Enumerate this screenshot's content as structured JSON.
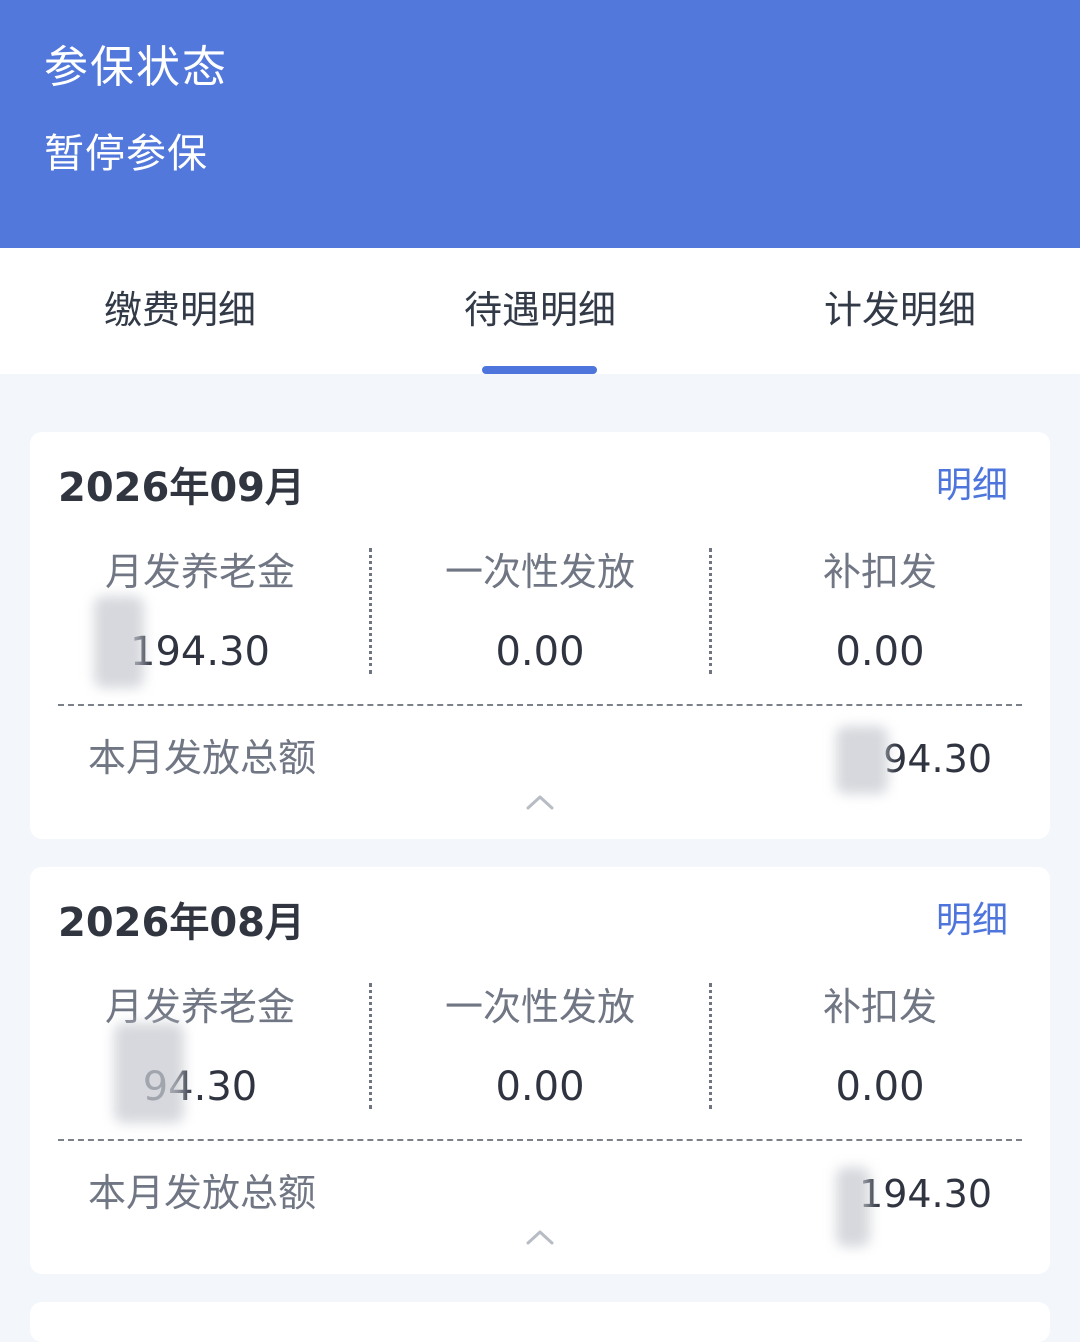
{
  "header": {
    "title": "参保状态",
    "status": "暂停参保"
  },
  "tabs": [
    {
      "label": "缴费明细",
      "active": false
    },
    {
      "label": "待遇明细",
      "active": true
    },
    {
      "label": "计发明细",
      "active": false
    }
  ],
  "colors": {
    "header_bg": "#5378dc",
    "accent": "#4e75dc",
    "page_bg": "#f3f6fa"
  },
  "cards": [
    {
      "month": "2026年09月",
      "detail_link": "明细",
      "columns": [
        {
          "label": "月发养老金",
          "value": "194.30"
        },
        {
          "label": "一次性发放",
          "value": "0.00"
        },
        {
          "label": "补扣发",
          "value": "0.00"
        }
      ],
      "total_label": "本月发放总额",
      "total_value": "94.30",
      "collapse_icon": "chevron-up-icon"
    },
    {
      "month": "2026年08月",
      "detail_link": "明细",
      "columns": [
        {
          "label": "月发养老金",
          "value": "94.30"
        },
        {
          "label": "一次性发放",
          "value": "0.00"
        },
        {
          "label": "补扣发",
          "value": "0.00"
        }
      ],
      "total_label": "本月发放总额",
      "total_value": "194.30",
      "collapse_icon": "chevron-up-icon"
    }
  ]
}
